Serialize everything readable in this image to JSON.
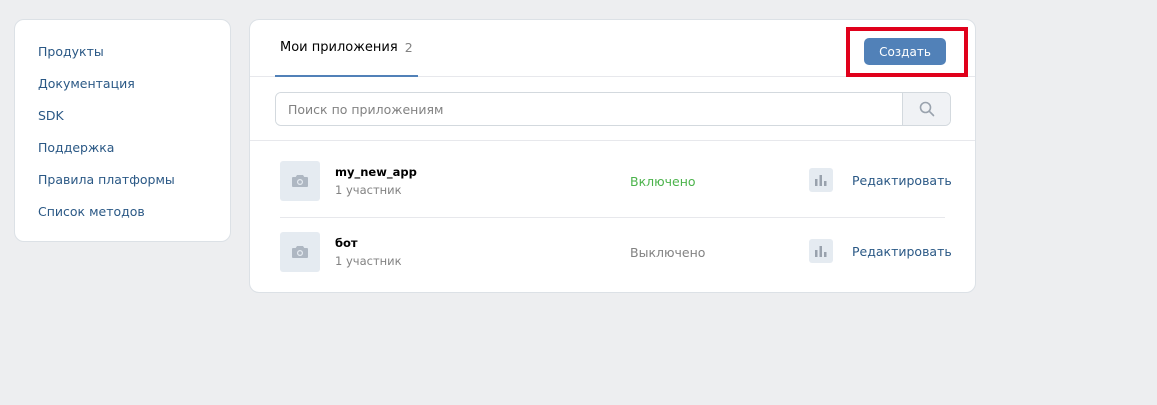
{
  "sidebar": {
    "items": [
      {
        "label": "Продукты"
      },
      {
        "label": "Документация"
      },
      {
        "label": "SDK"
      },
      {
        "label": "Поддержка"
      },
      {
        "label": "Правила платформы"
      },
      {
        "label": "Список методов"
      }
    ]
  },
  "main": {
    "tab": {
      "label": "Мои приложения",
      "count": "2"
    },
    "create_label": "Создать",
    "search": {
      "placeholder": "Поиск по приложениям",
      "value": ""
    },
    "apps": [
      {
        "name": "my_new_app",
        "members": "1 участник",
        "status": "Включено",
        "status_color": "#4bb34b",
        "edit_label": "Редактировать"
      },
      {
        "name": "бот",
        "members": "1 участник",
        "status": "Выключено",
        "status_color": "#828282",
        "edit_label": "Редактировать"
      }
    ]
  },
  "colors": {
    "accent": "#5181b8",
    "link": "#2a5885",
    "highlight": "#e0001b",
    "background": "#edeef0"
  },
  "icons": {
    "search": "search-icon",
    "app_placeholder": "camera-icon",
    "stats": "bar-chart-icon"
  }
}
